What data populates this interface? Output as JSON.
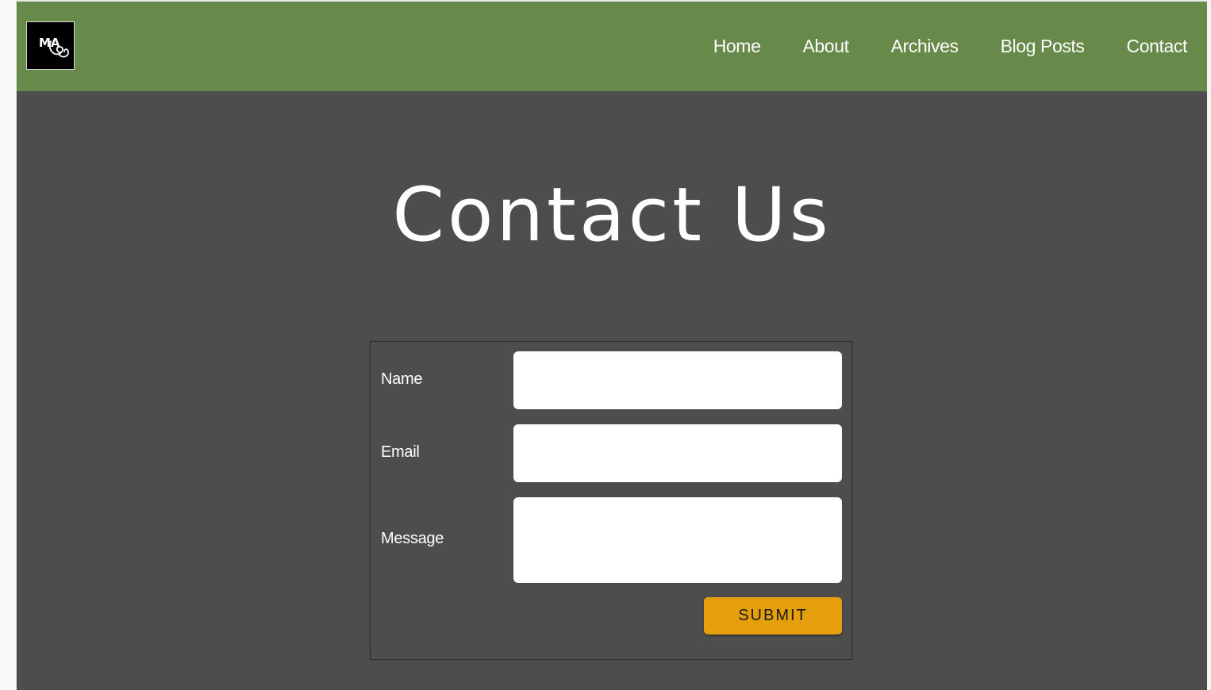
{
  "logo": {
    "text": "MA"
  },
  "nav": {
    "items": [
      {
        "label": "Home"
      },
      {
        "label": "About"
      },
      {
        "label": "Archives"
      },
      {
        "label": "Blog Posts"
      },
      {
        "label": "Contact"
      }
    ]
  },
  "page": {
    "title": "Contact Us"
  },
  "form": {
    "name_label": "Name",
    "name_value": "",
    "email_label": "Email",
    "email_value": "",
    "message_label": "Message",
    "message_value": "",
    "submit_label": "SUBMIT"
  },
  "colors": {
    "header": "#678a4a",
    "background": "#4d4d4d",
    "accent": "#e59e0c",
    "text": "#ffffff"
  }
}
